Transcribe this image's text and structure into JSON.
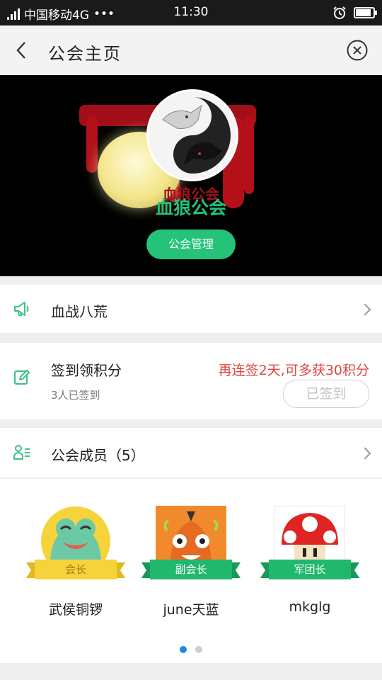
{
  "status_bar": {
    "carrier": "中国移动4G",
    "more": "•••",
    "time": "11:30"
  },
  "navbar": {
    "title": "公会主页"
  },
  "banner": {
    "guild_name": "血狼公会",
    "logo_text": "血狼公会",
    "manage_button": "公会管理",
    "colors": {
      "accent": "#25c27a",
      "blood": "#b4101a"
    }
  },
  "notice": {
    "label": "血战八荒"
  },
  "checkin": {
    "label": "签到领积分",
    "hint": "再连签2天,可多获30积分",
    "count_text": "3人已签到",
    "button": "已签到"
  },
  "members_header": {
    "label": "公会成员（5）"
  },
  "members": [
    {
      "name": "武侯铜锣",
      "role": "会长",
      "avatar_icon": "frog-avatar",
      "ribbon_color": "#f6d33a"
    },
    {
      "name": "june天蓝",
      "role": "副会长",
      "avatar_icon": "monster-avatar",
      "ribbon_color": "#21b86e"
    },
    {
      "name": "mkglg",
      "role": "军团长",
      "avatar_icon": "mushroom-avatar",
      "ribbon_color": "#21b86e"
    }
  ],
  "pagination": {
    "current": 1,
    "total": 2,
    "active_color": "#1e88e5"
  }
}
